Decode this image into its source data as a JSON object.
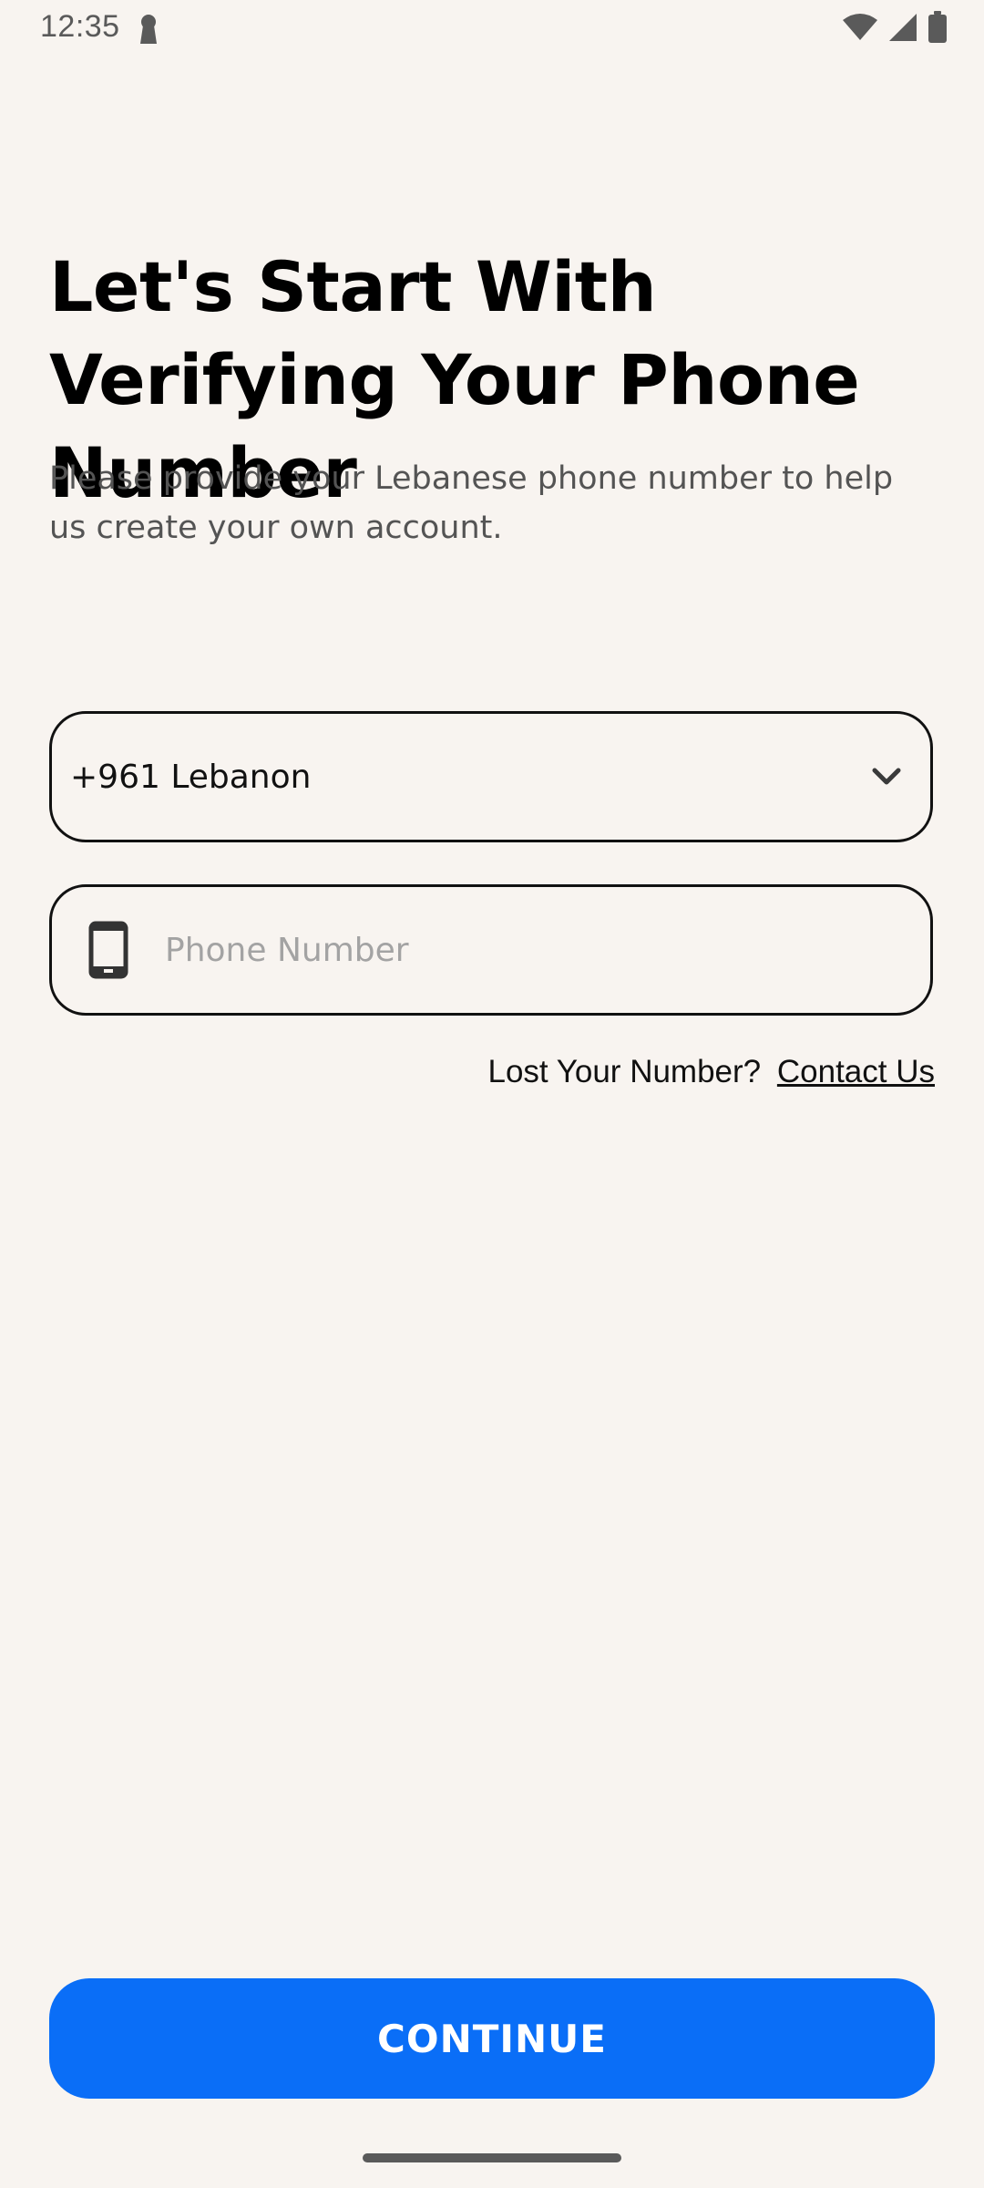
{
  "status_bar": {
    "time": "12:35",
    "icons": [
      "keyhole-icon",
      "wifi-icon",
      "signal-icon",
      "battery-icon"
    ]
  },
  "header": {
    "title": "Let's Start With Verifying Your Phone Number",
    "subtitle": "Please provide your Lebanese phone number to help us create your own account."
  },
  "form": {
    "country_select": {
      "value": "+961 Lebanon",
      "icon": "chevron-down-icon"
    },
    "phone_input": {
      "value": "",
      "placeholder": "Phone Number",
      "icon": "mobile-phone-icon"
    },
    "lost_number": {
      "text": "Lost Your Number?",
      "link": "Contact Us"
    }
  },
  "footer": {
    "continue_label": "CONTINUE"
  },
  "colors": {
    "background": "#f8f4f0",
    "primary": "#0a6ef7",
    "text": "#111111",
    "muted": "#545454",
    "placeholder": "#a3a3a3"
  }
}
